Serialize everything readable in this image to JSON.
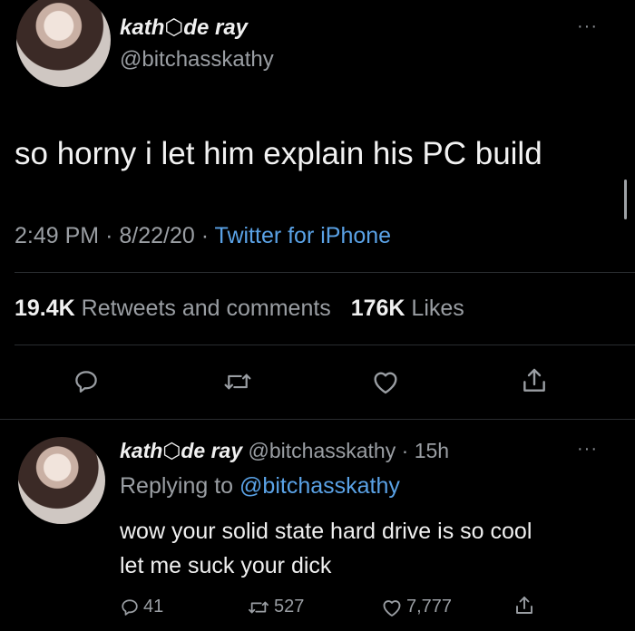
{
  "tweet": {
    "author_name": "kath⬡de ray",
    "handle": "@bitchasskathy",
    "text": "so horny i let him explain his PC build",
    "time": "2:49 PM",
    "date": "8/22/20",
    "source": "Twitter for iPhone",
    "retweets_count": "19.4K",
    "retweets_label": "Retweets and comments",
    "likes_count": "176K",
    "likes_label": "Likes",
    "more_label": "···"
  },
  "reply": {
    "author_name": "kath⬡de ray",
    "handle": "@bitchasskathy",
    "age": "15h",
    "replying_prefix": "Replying to",
    "replying_to": "@bitchasskathy",
    "text_line1": "wow your solid state hard drive is so cool",
    "text_line2": "let me suck your dick",
    "replies": "41",
    "retweets": "527",
    "likes": "7,777",
    "more_label": "···"
  },
  "separators": {
    "dot": "·"
  },
  "icons": [
    "reply-icon",
    "retweet-icon",
    "like-icon",
    "share-icon",
    "more-icon"
  ]
}
